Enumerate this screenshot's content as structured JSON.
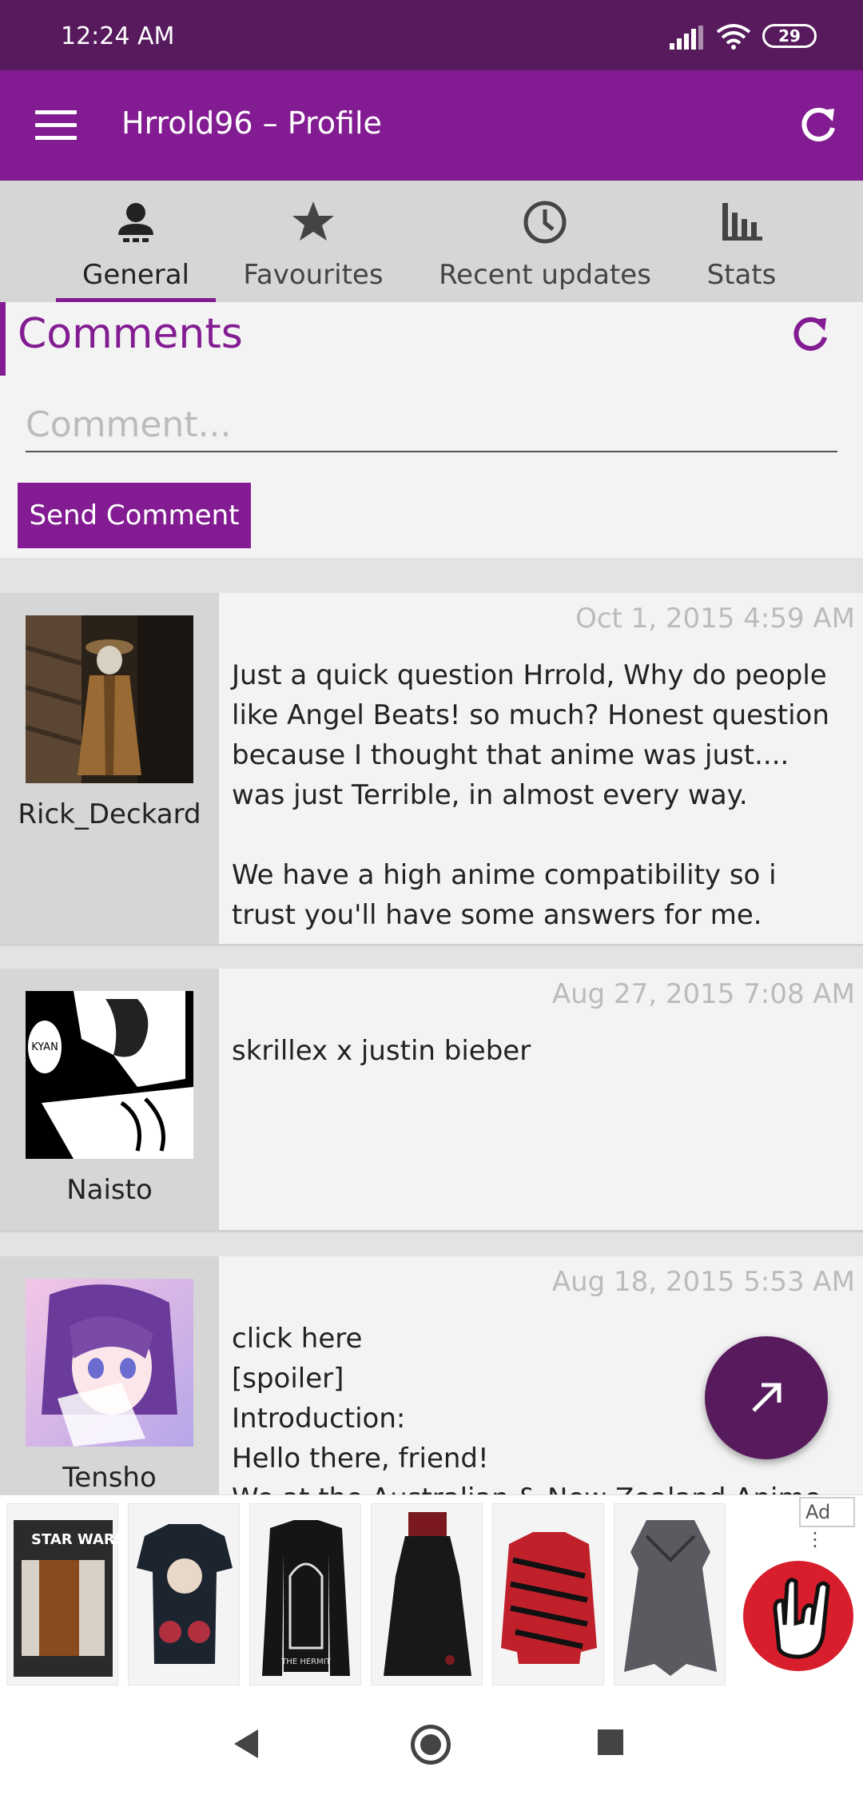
{
  "status_bar": {
    "time": "12:24 AM",
    "battery": "29"
  },
  "app_bar": {
    "title": "Hrrold96 – Profile"
  },
  "tabs": [
    {
      "label": "General",
      "icon": "person-icon",
      "active": true
    },
    {
      "label": "Favourites",
      "icon": "star-icon",
      "active": false
    },
    {
      "label": "Recent updates",
      "icon": "clock-icon",
      "active": false
    },
    {
      "label": "Stats",
      "icon": "bar-chart-icon",
      "active": false
    }
  ],
  "comments": {
    "heading": "Comments",
    "input_placeholder": "Comment...",
    "send_label": "Send Comment",
    "items": [
      {
        "user": "Rick_Deckard",
        "date": "Oct 1, 2015 4:59 AM",
        "text": "Just a quick question Hrrold, Why do people like Angel Beats! so much? Honest question because I thought that anime was just.... was just Terrible, in almost every way.\n\nWe have a high anime compatibility so i trust you'll have some answers for me."
      },
      {
        "user": "Naisto",
        "date": "Aug 27, 2015 7:08 AM",
        "text": "skrillex x justin bieber",
        "avatar_text": "KYAN"
      },
      {
        "user": "Tensho",
        "date": "Aug 18, 2015 5:53 AM",
        "text": "click here\n[spoiler]\nIntroduction:\nHello there, friend!\nWe at the Australian & New Zealand Anime"
      }
    ]
  },
  "ad": {
    "tag": "Ad",
    "first_product_text": "STAR WARS",
    "third_product_text": "THE HERMIT"
  },
  "colors": {
    "primary": "#831c92",
    "primary_dark": "#571a5d"
  }
}
